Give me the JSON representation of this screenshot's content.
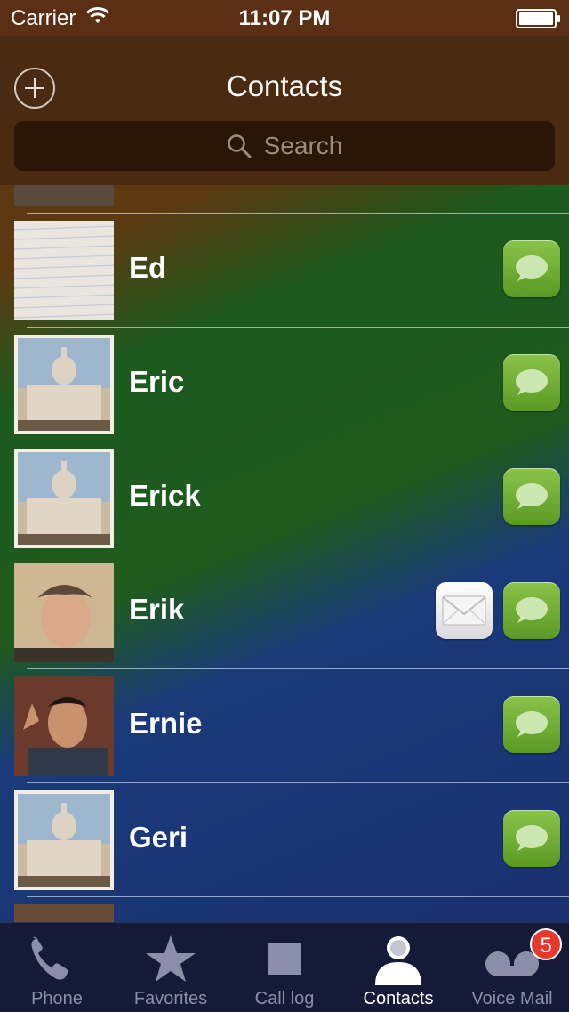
{
  "status_bar": {
    "carrier": "Carrier",
    "time": "11:07 PM"
  },
  "header": {
    "title": "Contacts",
    "add_icon": "plus-circle-icon"
  },
  "search": {
    "placeholder": "Search",
    "icon": "search-icon"
  },
  "contacts": [
    {
      "name": "Ed",
      "avatar": "lined-paper",
      "actions": [
        "message"
      ]
    },
    {
      "name": "Eric",
      "avatar": "capitol-building",
      "actions": [
        "message"
      ]
    },
    {
      "name": "Erick",
      "avatar": "capitol-building",
      "actions": [
        "message"
      ]
    },
    {
      "name": "Erik",
      "avatar": "man-photo",
      "actions": [
        "mail",
        "message"
      ]
    },
    {
      "name": "Ernie",
      "avatar": "man-shouting-photo",
      "actions": [
        "message"
      ]
    },
    {
      "name": "Geri",
      "avatar": "capitol-building",
      "actions": [
        "message"
      ]
    }
  ],
  "tabs": [
    {
      "label": "Phone",
      "icon": "phone-icon",
      "active": false
    },
    {
      "label": "Favorites",
      "icon": "star-icon",
      "active": false
    },
    {
      "label": "Call log",
      "icon": "square-icon",
      "active": false
    },
    {
      "label": "Contacts",
      "icon": "person-icon",
      "active": true
    },
    {
      "label": "Voice Mail",
      "icon": "voicemail-icon",
      "active": false,
      "badge": "5"
    }
  ],
  "colors": {
    "message_button": "#7cb342",
    "badge": "#e8372c",
    "tab_active": "#ffffff",
    "tab_inactive": "#8a8ea8"
  }
}
